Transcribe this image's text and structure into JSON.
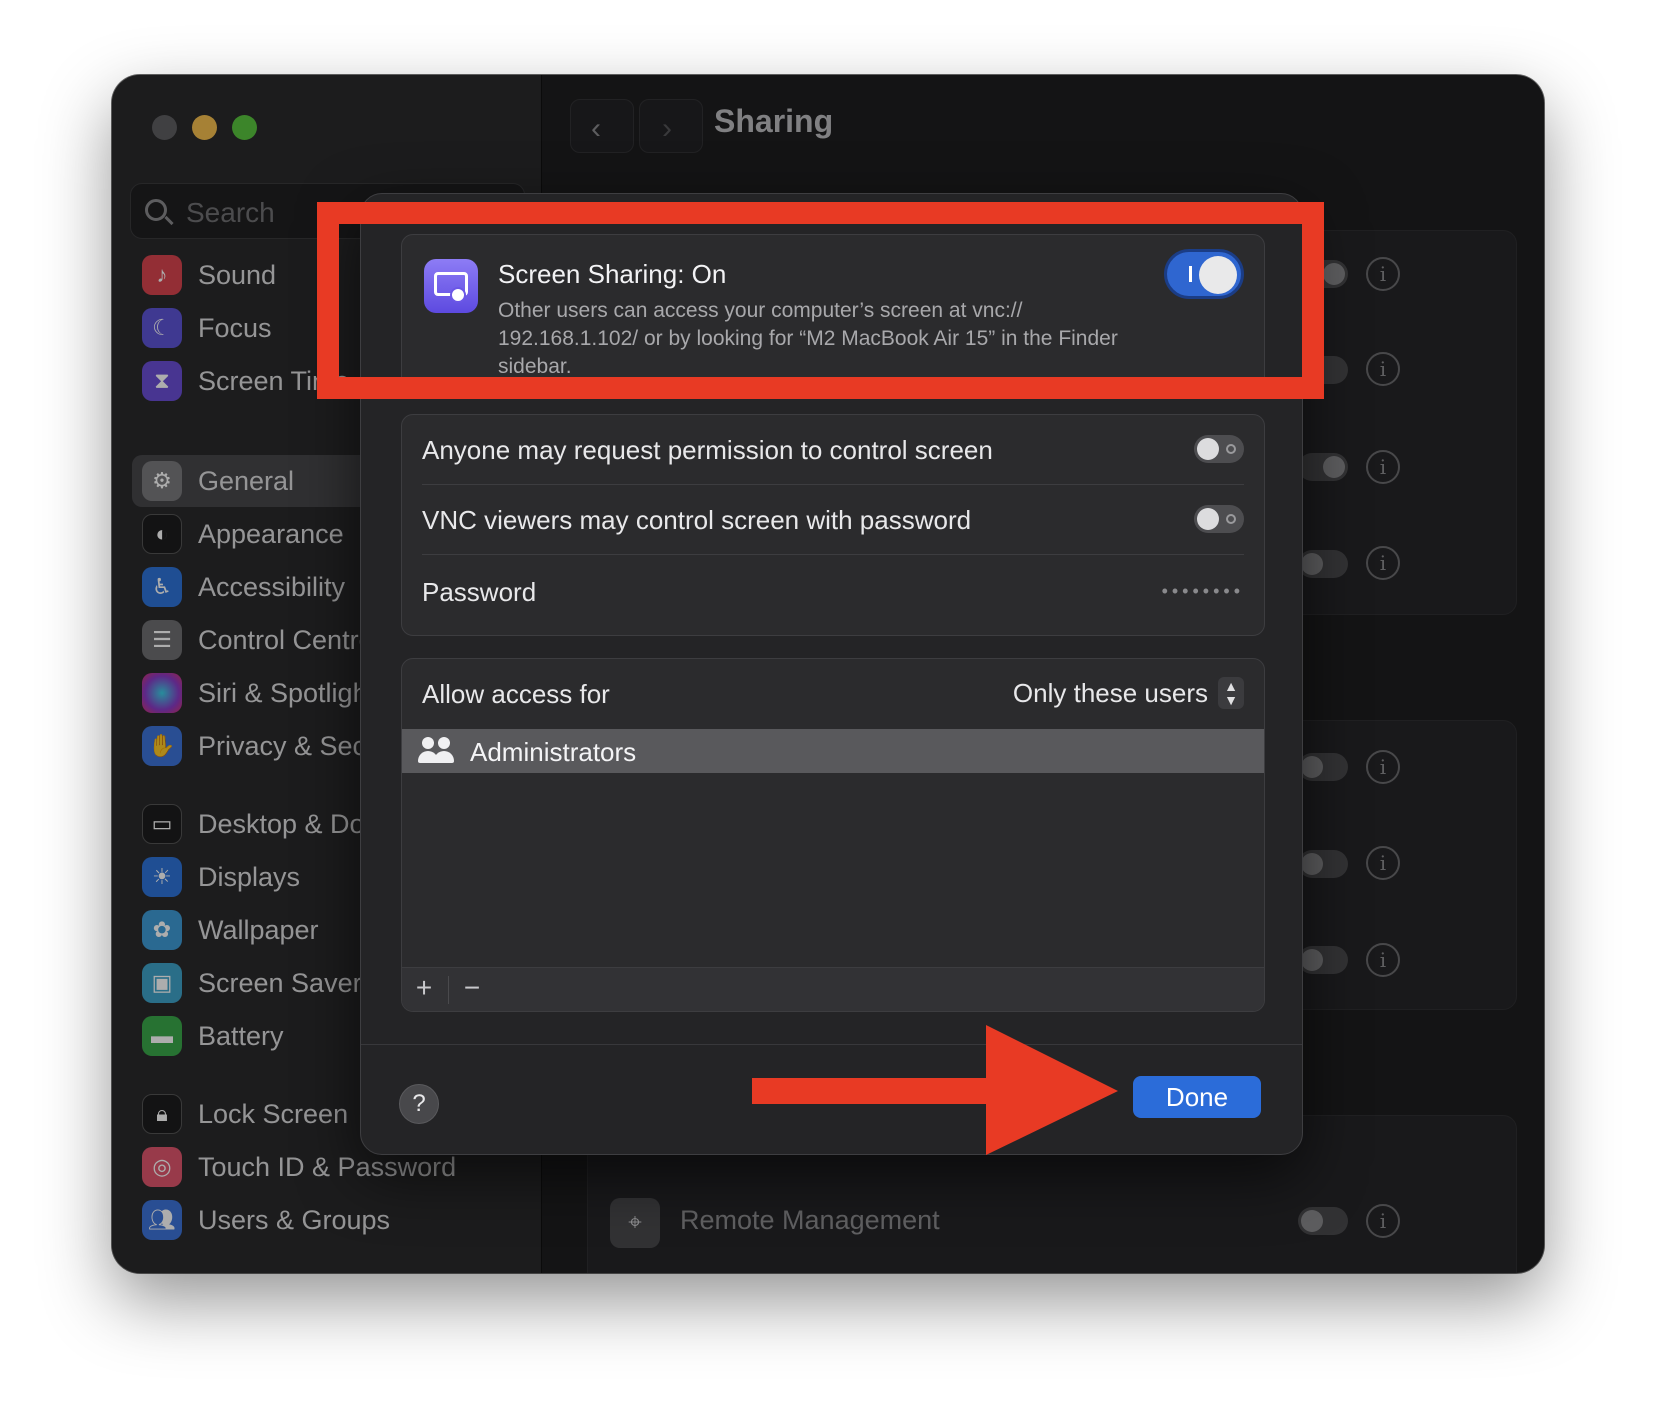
{
  "window": {
    "header_title": "Sharing",
    "nav_back": "‹",
    "nav_forward": "›"
  },
  "sidebar": {
    "search_placeholder": "Search",
    "items": [
      {
        "label": "Sound",
        "icon": "speaker-icon",
        "color": "#d9454f"
      },
      {
        "label": "Focus",
        "icon": "moon-icon",
        "color": "#5e54d6"
      },
      {
        "label": "Screen Time",
        "icon": "hourglass-icon",
        "color": "#6a4fd6"
      },
      {
        "label": "General",
        "icon": "gear-icon",
        "color": "#7b7b7e"
      },
      {
        "label": "Appearance",
        "icon": "appearance-icon",
        "color": "#1c1c1e"
      },
      {
        "label": "Accessibility",
        "icon": "accessibility-icon",
        "color": "#2f73d9"
      },
      {
        "label": "Control Centre",
        "icon": "control-centre-icon",
        "color": "#6f6f72"
      },
      {
        "label": "Siri & Spotlight",
        "icon": "siri-icon",
        "color": "#8a3bc7"
      },
      {
        "label": "Privacy & Security",
        "icon": "hand-icon",
        "color": "#3d74d9"
      },
      {
        "label": "Desktop & Dock",
        "icon": "dock-icon",
        "color": "#1c1c1e"
      },
      {
        "label": "Displays",
        "icon": "sun-icon",
        "color": "#2f73d9"
      },
      {
        "label": "Wallpaper",
        "icon": "flower-icon",
        "color": "#3f9bd6"
      },
      {
        "label": "Screen Saver",
        "icon": "screensaver-icon",
        "color": "#3fa3c9"
      },
      {
        "label": "Battery",
        "icon": "battery-icon",
        "color": "#3aa84a"
      },
      {
        "label": "Lock Screen",
        "icon": "lock-icon",
        "color": "#1c1c1e"
      },
      {
        "label": "Touch ID & Password",
        "icon": "fingerprint-icon",
        "color": "#e0566e"
      },
      {
        "label": "Users & Groups",
        "icon": "users-icon",
        "color": "#3d74d9"
      }
    ]
  },
  "background": {
    "remote_management_label": "Remote Management"
  },
  "sheet": {
    "screen_sharing_title": "Screen Sharing: On",
    "screen_sharing_desc": "Other users can access your computer’s screen at vnc:// 192.168.1.102/ or by looking for “M2 MacBook Air 15” in the Finder sidebar.",
    "screen_sharing_on": true,
    "anyone_request_label": "Anyone may request permission to control screen",
    "vnc_viewers_label": "VNC viewers may control screen with password",
    "password_label": "Password",
    "password_value": "••••••••",
    "allow_access_label": "Allow access for",
    "allow_access_value": "Only these users",
    "users": [
      "Administrators"
    ],
    "add_label": "+",
    "remove_label": "−",
    "help_label": "?",
    "done_label": "Done"
  },
  "annotation": {
    "highlight_color": "#e83a24"
  }
}
